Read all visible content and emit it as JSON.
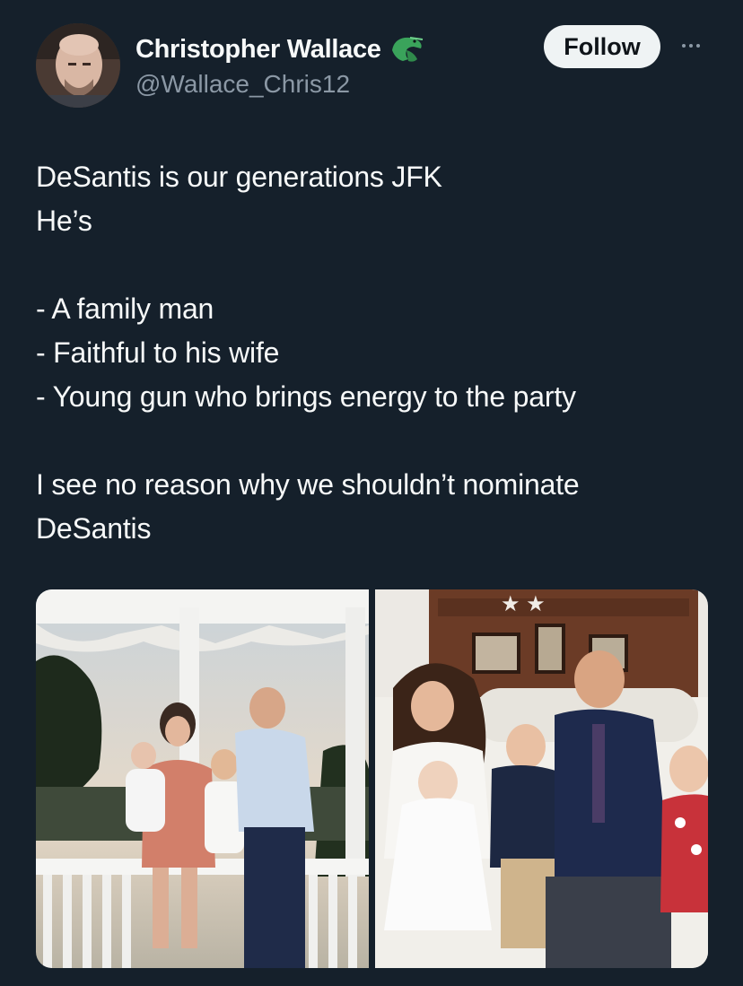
{
  "author": {
    "name": "Christopher Wallace",
    "handle": "@Wallace_Chris12"
  },
  "actions": {
    "follow_label": "Follow"
  },
  "tweet": {
    "lines": [
      "DeSantis is our generations JFK",
      "He’s",
      "",
      "- A family man",
      "- Faithful to his wife",
      "- Young gun who brings energy to the party",
      "",
      "I see no reason why we shouldn’t nominate",
      "DeSantis"
    ]
  },
  "icons": {
    "badge": "alligator-icon",
    "more": "more-options-icon"
  },
  "colors": {
    "background": "#15202b",
    "text": "#f7f9f9",
    "secondary": "#8b98a5",
    "follow_bg": "#eff3f4"
  }
}
